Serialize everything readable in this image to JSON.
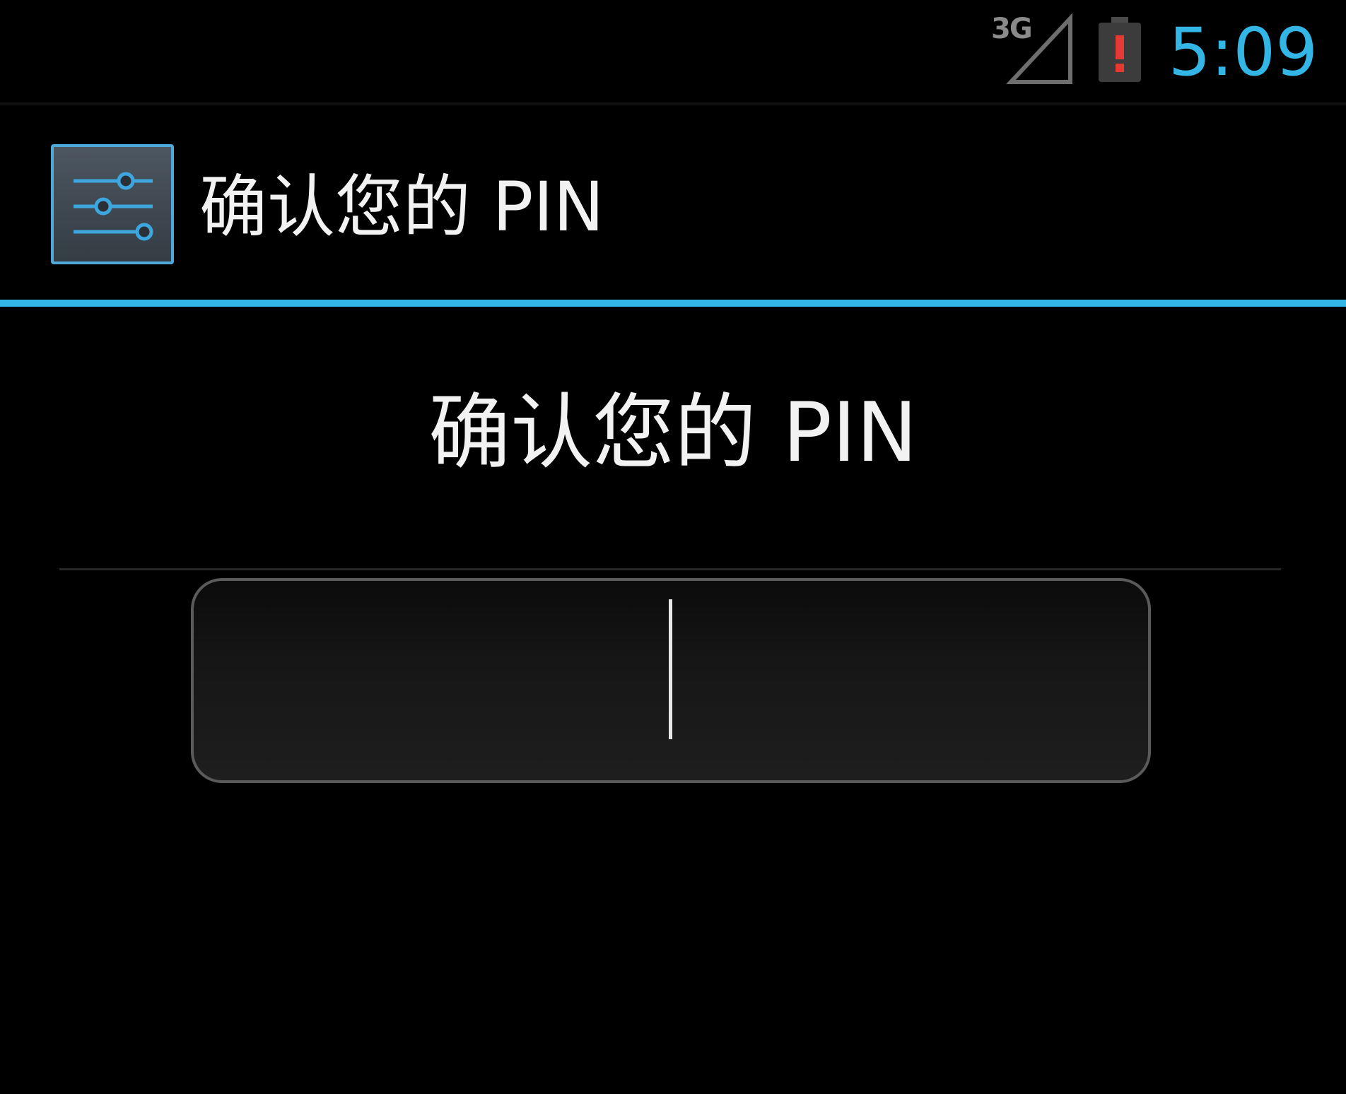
{
  "status_bar": {
    "network_type": "3G",
    "signal_icon": "signal-strength-icon",
    "battery_icon": "battery-alert-icon",
    "time": "5:09",
    "accent_color": "#33b5e5",
    "battery_alert_color": "#e53935"
  },
  "action_bar": {
    "icon": "settings-sliders-icon",
    "title": "确认您的 PIN"
  },
  "main": {
    "prompt": "确认您的 PIN",
    "pin_input": {
      "value": "",
      "placeholder": ""
    }
  }
}
